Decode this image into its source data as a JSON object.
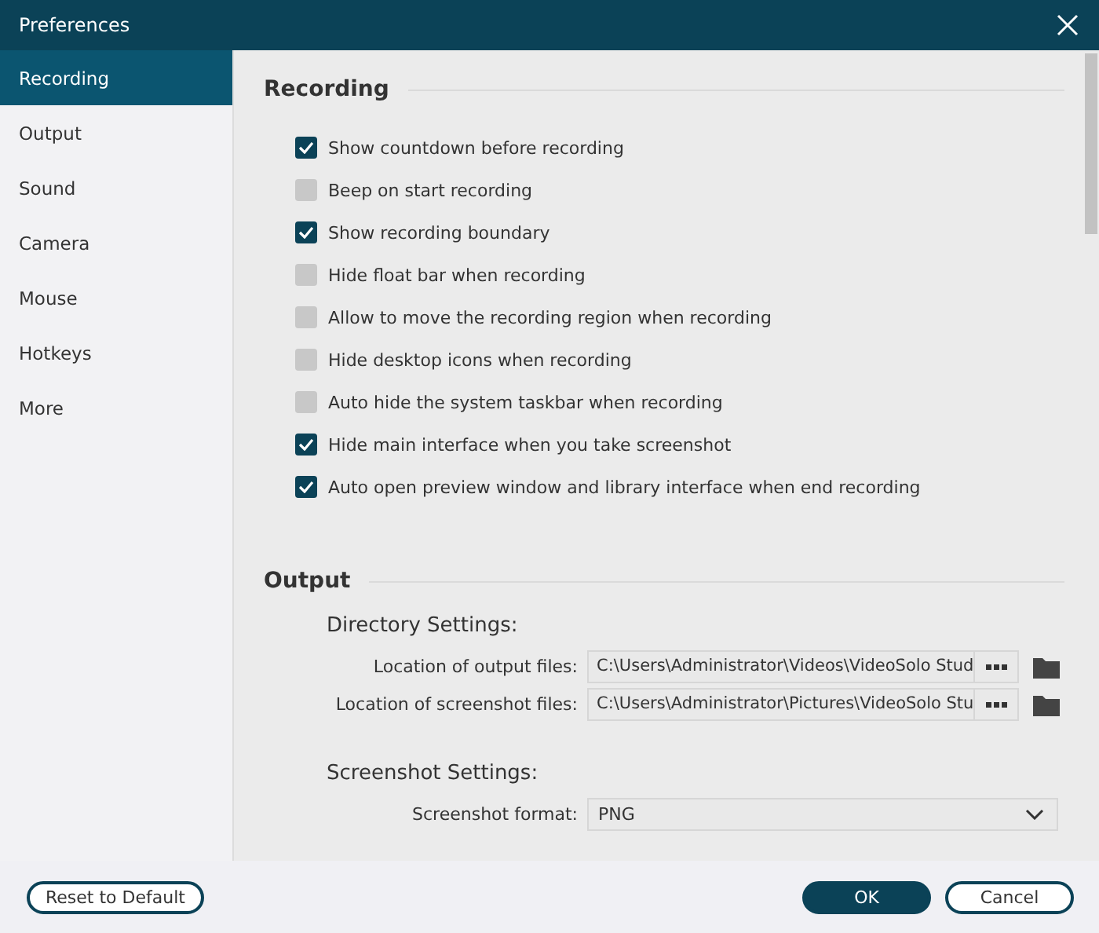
{
  "window": {
    "title": "Preferences"
  },
  "sidebar": {
    "items": [
      {
        "label": "Recording",
        "selected": true
      },
      {
        "label": "Output",
        "selected": false
      },
      {
        "label": "Sound",
        "selected": false
      },
      {
        "label": "Camera",
        "selected": false
      },
      {
        "label": "Mouse",
        "selected": false
      },
      {
        "label": "Hotkeys",
        "selected": false
      },
      {
        "label": "More",
        "selected": false
      }
    ]
  },
  "recording": {
    "heading": "Recording",
    "options": [
      {
        "label": "Show countdown before recording",
        "checked": true
      },
      {
        "label": "Beep on start recording",
        "checked": false
      },
      {
        "label": "Show recording boundary",
        "checked": true
      },
      {
        "label": "Hide float bar when recording",
        "checked": false
      },
      {
        "label": "Allow to move the recording region when recording",
        "checked": false
      },
      {
        "label": "Hide desktop icons when recording",
        "checked": false
      },
      {
        "label": "Auto hide the system taskbar when recording",
        "checked": false
      },
      {
        "label": "Hide main interface when you take screenshot",
        "checked": true
      },
      {
        "label": "Auto open preview window and library interface when end recording",
        "checked": true
      }
    ]
  },
  "output": {
    "heading": "Output",
    "directory_heading": "Directory Settings:",
    "paths": [
      {
        "label": "Location of output files:",
        "value": "C:\\Users\\Administrator\\Videos\\VideoSolo Stud"
      },
      {
        "label": "Location of screenshot files:",
        "value": "C:\\Users\\Administrator\\Pictures\\VideoSolo Stu"
      }
    ],
    "screenshot_heading": "Screenshot Settings:",
    "format": {
      "label": "Screenshot format:",
      "value": "PNG"
    }
  },
  "footer": {
    "reset": "Reset to Default",
    "ok": "OK",
    "cancel": "Cancel"
  }
}
